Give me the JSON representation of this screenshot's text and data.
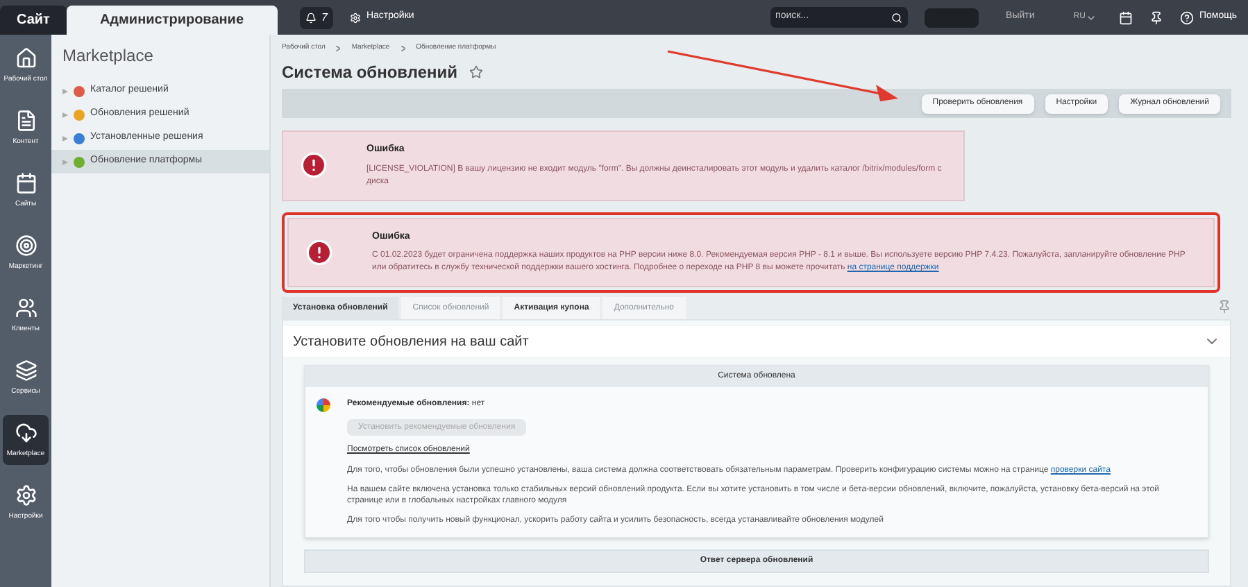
{
  "top_bar": {
    "tabs": [
      {
        "label": "Сайт",
        "selected": false
      },
      {
        "label": "Администрирование",
        "selected": true
      }
    ],
    "notifications": "7",
    "settings": "Настройки",
    "search": {
      "placeholder": "поиск..."
    },
    "logout": "Выйти",
    "language": "RU",
    "help": "Помощь"
  },
  "rail": [
    {
      "label": "Рабочий стол",
      "selected": false
    },
    {
      "label": "Контент",
      "selected": false
    },
    {
      "label": "Сайты",
      "selected": false
    },
    {
      "label": "Маркетинг",
      "selected": false
    },
    {
      "label": "Клиенты",
      "selected": false
    },
    {
      "label": "Сервисы",
      "selected": false
    },
    {
      "label": "Marketplace",
      "selected": true
    },
    {
      "label": "Настройки",
      "selected": false
    }
  ],
  "sidebar": {
    "title": "Marketplace",
    "items": [
      {
        "label": "Каталог решений",
        "color": "#e05a4a",
        "selected": false
      },
      {
        "label": "Обновления решений",
        "color": "#e8a524",
        "selected": false
      },
      {
        "label": "Установленные решения",
        "color": "#3a7fd5",
        "selected": false
      },
      {
        "label": "Обновление платформы",
        "color": "#6fae2e",
        "selected": true
      }
    ]
  },
  "breadcrumbs": [
    "Рабочий стол",
    "Marketplace",
    "Обновление платформы"
  ],
  "page_title": "Система обновлений",
  "toolbar_buttons": [
    "Проверить обновления",
    "Настройки",
    "Журнал обновлений"
  ],
  "errors": [
    {
      "title": "Ошибка",
      "text": "[LICENSE_VIOLATION] В вашу лицензию не входит модуль \"form\". Вы должны деинсталировать этот модуль и удалить каталог /bitrix/modules/form с диска",
      "highlighted": false
    },
    {
      "title": "Ошибка",
      "text": "С 01.02.2023 будет ограничена поддержка наших продуктов на PHP версии ниже 8.0. Рекомендуемая версия PHP - 8.1 и выше. Вы используете версию PHP 7.4.23. Пожалуйста, запланируйте обновление PHP или обратитесь в службу технической поддержки вашего хостинга. Подробнее о переходе на PHP 8 вы можете прочитать",
      "link": "на странице поддержки",
      "highlighted": true
    }
  ],
  "tabs": [
    {
      "label": "Установка обновлений",
      "selected": true,
      "disabled": false
    },
    {
      "label": "Список обновлений",
      "selected": false,
      "disabled": true
    },
    {
      "label": "Активация купона",
      "selected": false,
      "disabled": false
    },
    {
      "label": "Дополнительно",
      "selected": false,
      "disabled": true
    }
  ],
  "section_title": "Установите обновления на ваш сайт",
  "status_header": "Система обновлена",
  "recommended": {
    "label": "Рекомендуемые обновления:",
    "value": "нет"
  },
  "install_button": {
    "label": "Установить рекомендуемые обновления",
    "disabled": true
  },
  "view_list_link": "Посмотреть список обновлений",
  "paragraphs": [
    {
      "text": "Для того, чтобы обновления были успешно установлены, ваша система должна соответствовать обязательным параметрам. Проверить конфигурацию системы можно на странице",
      "link": "проверки сайта"
    },
    {
      "text": "На вашем сайте включена установка только стабильных версий обновлений продукта. Если вы хотите установить в том числе и бета-версии обновлений, включите, пожалуйста, установку бета-версий на этой странице или в глобальных настройках главного модуля"
    },
    {
      "text": "Для того чтобы получить новый функционал, ускорить работу сайта и усилить безопасность, всегда устанавливайте обновления модулей"
    }
  ],
  "server_header": "Ответ сервера обновлений"
}
